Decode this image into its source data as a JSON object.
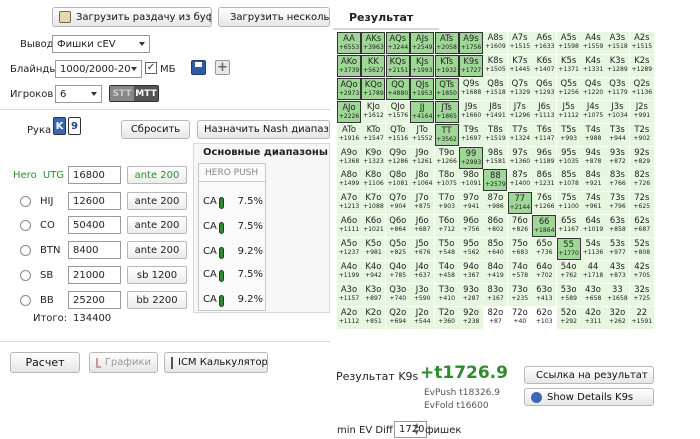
{
  "toolbar": {
    "load_clipboard": "Загрузить раздачу из буфера",
    "load_several": "Загрузить несколь"
  },
  "tab_result": "Результат",
  "settings": {
    "output_label": "Вывод",
    "output_value": "Фишки cEV",
    "blinds_label": "Блайнды",
    "blinds_value": "1000/2000-20",
    "mb_label": "МБ",
    "mb_checked": true,
    "players_label": "Игроков",
    "players_value": "6",
    "mode_stt": "STT",
    "mode_mtt": "MTT"
  },
  "hand": {
    "label": "Рука",
    "card1": "K",
    "card2": "9",
    "reset": "Сбросить",
    "assign_nash": "Назначить Nash диапазоны"
  },
  "ranges_title": "Основные диапазоны",
  "hero_push_title": "HERO PUSH",
  "push_rows": [
    {
      "tag": "CA",
      "pct": "7.5%"
    },
    {
      "tag": "CA",
      "pct": "7.5%"
    },
    {
      "tag": "CA",
      "pct": "9.2%"
    },
    {
      "tag": "CA",
      "pct": "7.5%"
    },
    {
      "tag": "CA",
      "pct": "9.2%"
    }
  ],
  "players": [
    {
      "pos": "Hero",
      "pos2": "UTG",
      "stack": "16800",
      "ante": "ante 200",
      "hero": true
    },
    {
      "pos": "HIJ",
      "pos2": "",
      "stack": "12600",
      "ante": "ante 200",
      "hero": false
    },
    {
      "pos": "CO",
      "pos2": "",
      "stack": "50400",
      "ante": "ante 200",
      "hero": false
    },
    {
      "pos": "BTN",
      "pos2": "",
      "stack": "8400",
      "ante": "ante 200",
      "hero": false
    },
    {
      "pos": "SB",
      "pos2": "",
      "stack": "21000",
      "ante": "sb 1200",
      "hero": false
    },
    {
      "pos": "BB",
      "pos2": "",
      "stack": "25200",
      "ante": "bb 2200",
      "hero": false
    }
  ],
  "total_label": "Итого:",
  "total_value": "134400",
  "bottom": {
    "calc": "Расчет",
    "graphs": "Графики",
    "icm": "ICM Калькулятор"
  },
  "result": {
    "label": "Результат K9s",
    "value": "+t1726.9",
    "evpush": "EvPush t18326.9",
    "evfold": "EvFold t16600",
    "link_btn": "Ссылка на результат",
    "details_btn": "Show Details K9s",
    "min_ev_label": "min EV Diff",
    "min_ev_value": "1720",
    "chips_label": "фишек"
  },
  "matrix": [
    [
      [
        "AA",
        "+6553",
        "p"
      ],
      [
        "AKs",
        "+3963",
        "p"
      ],
      [
        "AQs",
        "+3244",
        "p"
      ],
      [
        "AJs",
        "+2549",
        "p"
      ],
      [
        "ATs",
        "+2058",
        "p"
      ],
      [
        "A9s",
        "+1756",
        "p"
      ],
      [
        "A8s",
        "+1609",
        "g"
      ],
      [
        "A7s",
        "+1515",
        "g"
      ],
      [
        "A6s",
        "+1633",
        "g"
      ],
      [
        "A5s",
        "+1598",
        "g"
      ],
      [
        "A4s",
        "+1559",
        "g"
      ],
      [
        "A3s",
        "+1518",
        "g"
      ],
      [
        "A2s",
        "+1515",
        "g"
      ]
    ],
    [
      [
        "AKo",
        "+3739",
        "p"
      ],
      [
        "KK",
        "+5627",
        "p"
      ],
      [
        "KQs",
        "+2151",
        "p"
      ],
      [
        "KJs",
        "+1993",
        "p"
      ],
      [
        "KTs",
        "+1932",
        "p"
      ],
      [
        "K9s",
        "+1727",
        "p"
      ],
      [
        "K8s",
        "+1505",
        "g"
      ],
      [
        "K7s",
        "+1445",
        "g"
      ],
      [
        "K6s",
        "+1407",
        "g"
      ],
      [
        "K5s",
        "+1371",
        "g"
      ],
      [
        "K4s",
        "+1331",
        "g"
      ],
      [
        "K3s",
        "+1289",
        "g"
      ],
      [
        "K2s",
        "+1289",
        "g"
      ]
    ],
    [
      [
        "AQo",
        "+2973",
        "p"
      ],
      [
        "KQo",
        "+1789",
        "p"
      ],
      [
        "QQ",
        "+4880",
        "p"
      ],
      [
        "QJs",
        "+1953",
        "p"
      ],
      [
        "QTs",
        "+1850",
        "p"
      ],
      [
        "Q9s",
        "+1688",
        "g"
      ],
      [
        "Q8s",
        "+1518",
        "g"
      ],
      [
        "Q7s",
        "+1329",
        "g"
      ],
      [
        "Q6s",
        "+1293",
        "g"
      ],
      [
        "Q5s",
        "+1256",
        "g"
      ],
      [
        "Q4s",
        "+1220",
        "g"
      ],
      [
        "Q3s",
        "+1179",
        "g"
      ],
      [
        "Q2s",
        "+1136",
        "g"
      ]
    ],
    [
      [
        "AJo",
        "+2226",
        "p"
      ],
      [
        "KJo",
        "+1612",
        "g"
      ],
      [
        "QJo",
        "+1576",
        "g"
      ],
      [
        "JJ",
        "+4164",
        "p"
      ],
      [
        "JTs",
        "+1865",
        "p"
      ],
      [
        "J9s",
        "+1660",
        "g"
      ],
      [
        "J8s",
        "+1491",
        "g"
      ],
      [
        "J7s",
        "+1296",
        "g"
      ],
      [
        "J6s",
        "+1113",
        "g"
      ],
      [
        "J5s",
        "+1112",
        "g"
      ],
      [
        "J4s",
        "+1075",
        "g"
      ],
      [
        "J3s",
        "+1034",
        "g"
      ],
      [
        "J2s",
        "+991",
        "g"
      ]
    ],
    [
      [
        "ATo",
        "+1916",
        "g"
      ],
      [
        "KTo",
        "+1547",
        "g"
      ],
      [
        "QTo",
        "+1516",
        "g"
      ],
      [
        "JTo",
        "+1552",
        "g"
      ],
      [
        "TT",
        "+3562",
        "p"
      ],
      [
        "T9s",
        "+1697",
        "g"
      ],
      [
        "T8s",
        "+1519",
        "g"
      ],
      [
        "T7s",
        "+1324",
        "g"
      ],
      [
        "T6s",
        "+1147",
        "g"
      ],
      [
        "T5s",
        "+993",
        "g"
      ],
      [
        "T4s",
        "+988",
        "g"
      ],
      [
        "T3s",
        "+944",
        "g"
      ],
      [
        "T2s",
        "+902",
        "g"
      ]
    ],
    [
      [
        "A9o",
        "+1368",
        "g"
      ],
      [
        "K9o",
        "+1323",
        "g"
      ],
      [
        "Q9o",
        "+1286",
        "g"
      ],
      [
        "J9o",
        "+1261",
        "g"
      ],
      [
        "T9o",
        "+1266",
        "g"
      ],
      [
        "99",
        "+2993",
        "p"
      ],
      [
        "98s",
        "+1581",
        "g"
      ],
      [
        "97s",
        "+1360",
        "g"
      ],
      [
        "96s",
        "+1189",
        "g"
      ],
      [
        "95s",
        "+1035",
        "g"
      ],
      [
        "94s",
        "+878",
        "g"
      ],
      [
        "93s",
        "+872",
        "g"
      ],
      [
        "92s",
        "+829",
        "g"
      ]
    ],
    [
      [
        "A8o",
        "+1499",
        "g"
      ],
      [
        "K8o",
        "+1106",
        "g"
      ],
      [
        "Q8o",
        "+1081",
        "g"
      ],
      [
        "J8o",
        "+1064",
        "g"
      ],
      [
        "T8o",
        "+1075",
        "g"
      ],
      [
        "98o",
        "+1091",
        "g"
      ],
      [
        "88",
        "+2579",
        "p"
      ],
      [
        "87s",
        "+1400",
        "g"
      ],
      [
        "86s",
        "+1231",
        "g"
      ],
      [
        "85s",
        "+1078",
        "g"
      ],
      [
        "84s",
        "+921",
        "g"
      ],
      [
        "83s",
        "+766",
        "g"
      ],
      [
        "82s",
        "+726",
        "g"
      ]
    ],
    [
      [
        "A7o",
        "+1213",
        "g"
      ],
      [
        "K7o",
        "+1088",
        "g"
      ],
      [
        "Q7o",
        "+904",
        "g"
      ],
      [
        "J7o",
        "+875",
        "g"
      ],
      [
        "T7o",
        "+903",
        "g"
      ],
      [
        "97o",
        "+941",
        "g"
      ],
      [
        "87o",
        "+986",
        "g"
      ],
      [
        "77",
        "+2144",
        "p"
      ],
      [
        "76s",
        "+1266",
        "g"
      ],
      [
        "75s",
        "+1100",
        "g"
      ],
      [
        "74s",
        "+961",
        "g"
      ],
      [
        "73s",
        "+796",
        "g"
      ],
      [
        "72s",
        "+625",
        "g"
      ]
    ],
    [
      [
        "A6o",
        "+1111",
        "g"
      ],
      [
        "K6o",
        "+1021",
        "g"
      ],
      [
        "Q6o",
        "+864",
        "g"
      ],
      [
        "J6o",
        "+687",
        "g"
      ],
      [
        "T6o",
        "+712",
        "g"
      ],
      [
        "96o",
        "+756",
        "g"
      ],
      [
        "86o",
        "+802",
        "g"
      ],
      [
        "76o",
        "+826",
        "g"
      ],
      [
        "66",
        "+1864",
        "p"
      ],
      [
        "65s",
        "+1167",
        "g"
      ],
      [
        "64s",
        "+1019",
        "g"
      ],
      [
        "63s",
        "+858",
        "g"
      ],
      [
        "62s",
        "+687",
        "g"
      ]
    ],
    [
      [
        "A5o",
        "+1237",
        "g"
      ],
      [
        "K5o",
        "+981",
        "g"
      ],
      [
        "Q5o",
        "+825",
        "g"
      ],
      [
        "J5o",
        "+676",
        "g"
      ],
      [
        "T5o",
        "+548",
        "g"
      ],
      [
        "95o",
        "+562",
        "g"
      ],
      [
        "85o",
        "+640",
        "g"
      ],
      [
        "75o",
        "+683",
        "g"
      ],
      [
        "65o",
        "+736",
        "g"
      ],
      [
        "55",
        "+1770",
        "p"
      ],
      [
        "54s",
        "+1136",
        "g"
      ],
      [
        "53s",
        "+977",
        "g"
      ],
      [
        "52s",
        "+808",
        "g"
      ]
    ],
    [
      [
        "A4o",
        "+1199",
        "g"
      ],
      [
        "K4o",
        "+942",
        "g"
      ],
      [
        "Q4o",
        "+785",
        "g"
      ],
      [
        "J4o",
        "+637",
        "g"
      ],
      [
        "T4o",
        "+458",
        "g"
      ],
      [
        "94o",
        "+367",
        "g"
      ],
      [
        "84o",
        "+419",
        "g"
      ],
      [
        "74o",
        "+578",
        "g"
      ],
      [
        "64o",
        "+702",
        "g"
      ],
      [
        "54o",
        "+762",
        "g"
      ],
      [
        "44",
        "+1718",
        "g"
      ],
      [
        "43s",
        "+873",
        "g"
      ],
      [
        "42s",
        "+705",
        "g"
      ]
    ],
    [
      [
        "A3o",
        "+1157",
        "g"
      ],
      [
        "K3o",
        "+897",
        "g"
      ],
      [
        "Q3o",
        "+740",
        "g"
      ],
      [
        "J3o",
        "+590",
        "g"
      ],
      [
        "T3o",
        "+410",
        "g"
      ],
      [
        "93o",
        "+287",
        "g"
      ],
      [
        "83o",
        "+167",
        "g"
      ],
      [
        "73o",
        "+235",
        "g"
      ],
      [
        "63o",
        "+413",
        "g"
      ],
      [
        "53o",
        "+589",
        "g"
      ],
      [
        "43o",
        "+658",
        "g"
      ],
      [
        "33",
        "+1658",
        "g"
      ],
      [
        "32s",
        "+725",
        "g"
      ]
    ],
    [
      [
        "A2o",
        "+1112",
        "g"
      ],
      [
        "K2o",
        "+851",
        "g"
      ],
      [
        "Q2o",
        "+694",
        "g"
      ],
      [
        "J2o",
        "+544",
        "g"
      ],
      [
        "T2o",
        "+360",
        "g"
      ],
      [
        "92o",
        "+238",
        "g"
      ],
      [
        "82o",
        "+87",
        "w"
      ],
      [
        "72o",
        "+40",
        "w"
      ],
      [
        "62o",
        "+103",
        "w"
      ],
      [
        "52o",
        "+292",
        "g"
      ],
      [
        "42o",
        "+311",
        "g"
      ],
      [
        "32o",
        "+262",
        "g"
      ],
      [
        "22",
        "+1591",
        "g"
      ]
    ]
  ],
  "colors": {
    "push": "#9fd896",
    "fold_plus": "#e6f6df",
    "result_green": "#2e8b2e",
    "accent_blue": "#3a68b5"
  }
}
